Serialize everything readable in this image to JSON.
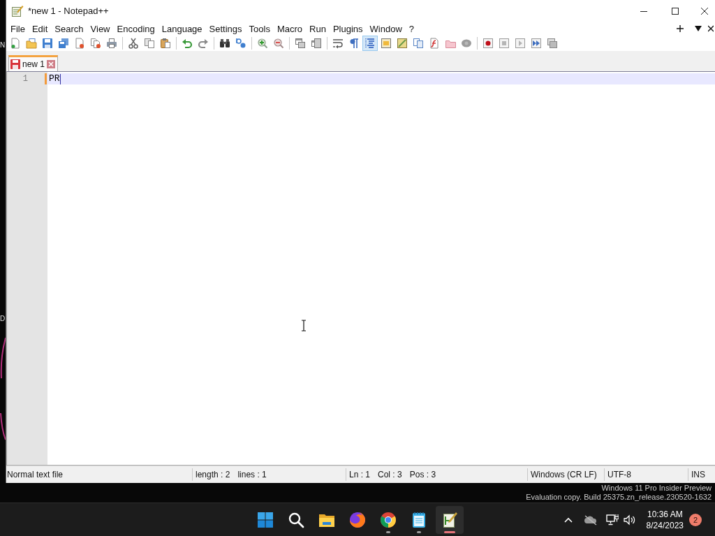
{
  "desktop": {
    "label_fragments": [
      "N",
      "D"
    ]
  },
  "window": {
    "title": "*new 1 - Notepad++"
  },
  "menu_bar": {
    "items": [
      "File",
      "Edit",
      "Search",
      "View",
      "Encoding",
      "Language",
      "Settings",
      "Tools",
      "Macro",
      "Run",
      "Plugins",
      "Window",
      "?"
    ],
    "tab_controls": [
      {
        "kind": "add"
      },
      {
        "kind": "list"
      },
      {
        "kind": "close"
      }
    ]
  },
  "toolbar": [
    [
      {
        "kind": "new",
        "on": false
      },
      {
        "kind": "open",
        "on": false
      },
      {
        "kind": "save",
        "on": false
      },
      {
        "kind": "saveall",
        "on": false
      },
      {
        "kind": "close",
        "on": false
      },
      {
        "kind": "closeall",
        "on": false
      },
      {
        "kind": "print",
        "on": false
      }
    ],
    [
      {
        "kind": "cut",
        "on": false
      },
      {
        "kind": "copy",
        "on": false
      },
      {
        "kind": "paste",
        "on": false
      }
    ],
    [
      {
        "kind": "undo",
        "on": false
      },
      {
        "kind": "redo",
        "on": false
      }
    ],
    [
      {
        "kind": "find",
        "on": false
      },
      {
        "kind": "replace",
        "on": false
      }
    ],
    [
      {
        "kind": "zoomin",
        "on": false
      },
      {
        "kind": "zoomout",
        "on": false
      }
    ],
    [
      {
        "kind": "syncv",
        "on": false
      },
      {
        "kind": "synch",
        "on": false
      }
    ],
    [
      {
        "kind": "wrap",
        "on": false
      },
      {
        "kind": "pilcrow",
        "on": false
      },
      {
        "kind": "indent",
        "on": true
      },
      {
        "kind": "udl",
        "on": false
      },
      {
        "kind": "map",
        "on": false
      },
      {
        "kind": "doclist",
        "on": false
      },
      {
        "kind": "funclist",
        "on": false
      },
      {
        "kind": "folder",
        "on": false
      },
      {
        "kind": "monitor",
        "on": false
      }
    ],
    [
      {
        "kind": "record",
        "on": false
      },
      {
        "kind": "stop",
        "on": false
      },
      {
        "kind": "play",
        "on": false
      },
      {
        "kind": "playmulti",
        "on": false
      },
      {
        "kind": "savemacro",
        "on": false
      }
    ]
  ],
  "tabs": [
    {
      "label": "new 1",
      "selected": true,
      "modified": true
    }
  ],
  "editor": {
    "lines": [
      {
        "number": "1",
        "text": "PR",
        "current": true,
        "changed": true
      }
    ]
  },
  "status_bar": [
    [
      "Normal text file"
    ],
    [
      "length : 2",
      "lines : 1"
    ],
    [
      "Ln : 1",
      "Col : 3",
      "Pos : 3"
    ],
    [
      "Windows (CR LF)"
    ],
    [
      "UTF-8"
    ],
    [
      "INS"
    ]
  ],
  "watermark": [
    "Windows 11 Pro Insider Preview",
    "Evaluation copy. Build 25375.zn_release.230520-1632"
  ],
  "taskbar": {
    "apps": [
      {
        "kind": "start",
        "running": false,
        "active": false
      },
      {
        "kind": "search",
        "running": false,
        "active": false
      },
      {
        "kind": "explorer",
        "running": false,
        "active": false
      },
      {
        "kind": "firefox",
        "running": false,
        "active": false
      },
      {
        "kind": "chrome",
        "running": true,
        "active": false
      },
      {
        "kind": "notepad",
        "running": true,
        "active": false
      },
      {
        "kind": "notepadpp",
        "running": true,
        "active": true
      }
    ],
    "tray": [
      {
        "kind": "chevron"
      },
      {
        "kind": "cloud"
      },
      {
        "kind": "network"
      },
      {
        "kind": "volume"
      }
    ],
    "time": "10:36 AM",
    "date": "8/24/2023",
    "notifications": "2"
  }
}
